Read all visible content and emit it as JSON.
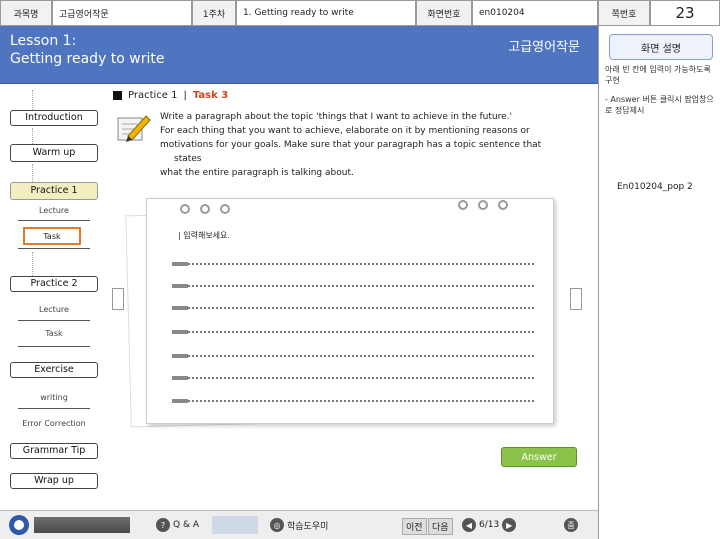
{
  "header": {
    "course_label": "과목명",
    "course_name": "고급영어작문",
    "week": "1주차",
    "lesson_name": "1. Getting ready to write",
    "screen_no_label": "화면번호",
    "screen_no": "en010204",
    "page_no_label": "쪽번호",
    "page_no": "23"
  },
  "titlebar": {
    "lesson_line1": "Lesson 1:",
    "lesson_line2": "Getting ready to write",
    "course": "고급영어작문"
  },
  "right_panel": {
    "title": "화면 설명",
    "desc1": "아래 빈 칸에 입력이 가능하도록 구현",
    "desc2": "- Answer 버튼 클릭시 팝업창으로 정답제시",
    "popup": "En010204_pop 2"
  },
  "nav": {
    "introduction": "Introduction",
    "warm_up": "Warm up",
    "practice1": "Practice 1",
    "lecture1": "Lecture",
    "task1": "Task",
    "practice2": "Practice 2",
    "lecture2": "Lecture",
    "task2": "Task",
    "exercise": "Exercise",
    "writing": "writing",
    "error_correction": "Error Correction",
    "grammar_tip": "Grammar Tip",
    "wrap_up": "Wrap up"
  },
  "content": {
    "practice_label": "Practice 1",
    "separator": "|",
    "task_label": "Task 3",
    "instr_line1": "Write a paragraph about the topic 'things that I want to achieve in the future.'",
    "instr_line2": "For each thing that you want to achieve, elaborate on it by mentioning reasons or",
    "instr_line3": "motivations for your goals. Make sure that your paragraph has a topic sentence that",
    "instr_line4": "states",
    "instr_line5": "what the entire paragraph is talking about.",
    "input_prompt": "| 입력해보세요.",
    "answer_button": "Answer"
  },
  "footer": {
    "qa_label": "Q & A",
    "study_label": "학습도우미",
    "prev_label": "이전",
    "next_label": "다음",
    "page_indicator": "6/13",
    "zoom_label": "줌"
  },
  "colors": {
    "title_bar": "#4f74c0",
    "task_highlight": "#e07a2c",
    "answer_button": "#8bc34a",
    "active_nav": "#f3eec0"
  }
}
